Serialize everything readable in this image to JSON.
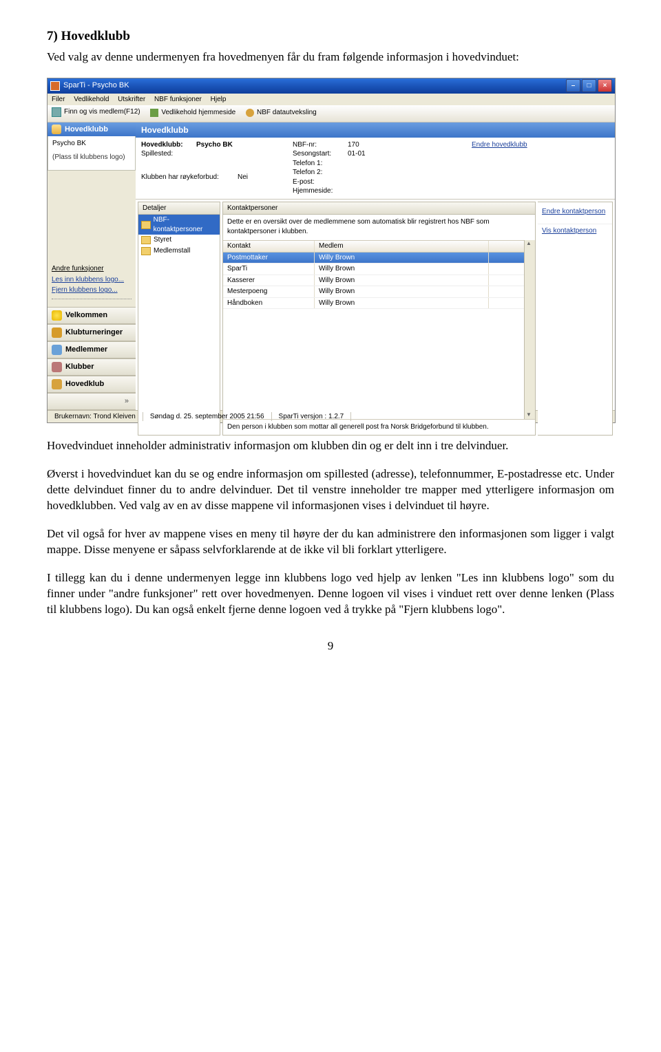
{
  "heading": "7) Hovedklubb",
  "intro": "Ved valg av denne undermenyen fra hovedmenyen får du fram følgende informasjon i hovedvinduet:",
  "paragraphs": {
    "p1": "Hovedvinduet inneholder administrativ informasjon om klubben din og er delt inn i tre delvinduer.",
    "p2": "Øverst i hovedvinduet kan du se og endre informasjon om spillested (adresse), telefonnummer, E-postadresse etc. Under dette delvinduet finner du to andre delvinduer. Det til venstre inneholder tre mapper med ytterligere informasjon om hovedklubben. Ved valg av en av disse mappene vil informasjonen vises i delvinduet til høyre.",
    "p3": "Det vil også for hver av mappene vises en meny til høyre der du kan administrere den informasjonen som ligger i valgt mappe. Disse menyene er såpass selvforklarende at de ikke vil bli forklart ytterligere.",
    "p4": "I tillegg kan du i denne undermenyen legge inn klubbens logo ved hjelp av lenken \"Les inn klubbens logo\" som du finner under \"andre funksjoner\" rett over hovedmenyen. Denne logoen vil vises i vinduet rett over denne lenken (Plass til klubbens logo). Du kan også enkelt fjerne denne logoen ved å trykke på \"Fjern klubbens logo\"."
  },
  "page_number": "9",
  "screenshot": {
    "title": "SparTi - Psycho BK",
    "menus": [
      "Filer",
      "Vedlikehold",
      "Utskrifter",
      "NBF funksjoner",
      "Hjelp"
    ],
    "toolbar": {
      "find": "Finn og vis medlem(F12)",
      "maint": "Vedlikehold hjemmeside",
      "exchange": "NBF datautveksling"
    },
    "leftnav": {
      "top_header": "Hovedklubb",
      "club_name": "Psycho BK",
      "logo_placeholder": "(Plass til klubbens logo)",
      "other_funcs": "Andre funksjoner",
      "link_read_logo": "Les inn klubbens logo...",
      "link_remove_logo": "Fjern klubbens logo...",
      "buttons": {
        "welcome": "Velkommen",
        "tournaments": "Klubturneringer",
        "members": "Medlemmer",
        "clubs": "Klubber",
        "mainclub": "Hovedklub"
      }
    },
    "right": {
      "header": "Hovedklubb",
      "club": {
        "label_hovedklubb": "Hovedklubb:",
        "hovedklubb": "Psycho BK",
        "label_spillested": "Spillested:",
        "spillested": "",
        "label_royk": "Klubben har røykeforbud:",
        "royk": "Nei",
        "label_nbfnr": "NBF-nr:",
        "nbfnr": "170",
        "label_sesong": "Sesongstart:",
        "sesong": "01-01",
        "label_tel1": "Telefon 1:",
        "tel1": "",
        "label_tel2": "Telefon 2:",
        "tel2": "",
        "label_epost": "E-post:",
        "epost": "",
        "label_hjemmeside": "Hjemmeside:",
        "hjemmeside": "",
        "edit_link": "Endre hovedklubb"
      },
      "details": {
        "header": "Detaljer",
        "items": [
          "NBF-kontaktpersoner",
          "Styret",
          "Medlemstall"
        ]
      },
      "contacts": {
        "header": "Kontaktpersoner",
        "desc": "Dette er en oversikt over de medlemmene som automatisk blir registrert hos NBF som kontaktpersoner i klubben.",
        "col_contact": "Kontakt",
        "col_member": "Medlem",
        "rows": [
          {
            "k": "Postmottaker",
            "m": "Willy Brown"
          },
          {
            "k": "SparTi",
            "m": "Willy Brown"
          },
          {
            "k": "Kasserer",
            "m": "Willy Brown"
          },
          {
            "k": "Mesterpoeng",
            "m": "Willy Brown"
          },
          {
            "k": "Håndboken",
            "m": "Willy Brown"
          }
        ],
        "note": "Den person i klubben som mottar all generell post fra Norsk Bridgeforbund til klubben."
      },
      "rightlinks": {
        "edit_contact": "Endre kontaktperson",
        "show_contact": "Vis kontaktperson"
      }
    },
    "statusbar": {
      "user_label": "Brukernavn:",
      "user": "Trond Kleiven",
      "date": "Søndag d. 25. september 2005 21:56",
      "version_label": "SparTi versjon :",
      "version": "1.2.7"
    }
  }
}
